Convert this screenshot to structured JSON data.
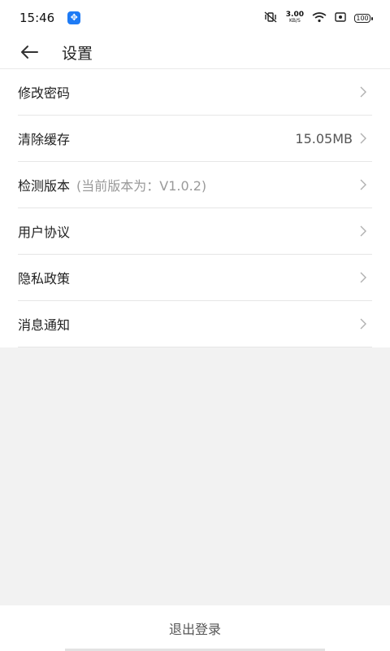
{
  "status_bar": {
    "time": "15:46",
    "app_icon": "app-icon",
    "speed_value": "3.00",
    "speed_unit": "KB/S",
    "battery": "100"
  },
  "header": {
    "title": "设置",
    "back_icon": "arrow-left-icon"
  },
  "settings": {
    "items": [
      {
        "label": "修改密码",
        "sub": "",
        "value": ""
      },
      {
        "label": "清除缓存",
        "sub": "",
        "value": "15.05MB"
      },
      {
        "label": "检测版本",
        "sub": "(当前版本为：V1.0.2)",
        "value": ""
      },
      {
        "label": "用户协议",
        "sub": "",
        "value": ""
      },
      {
        "label": "隐私政策",
        "sub": "",
        "value": ""
      },
      {
        "label": "消息通知",
        "sub": "",
        "value": ""
      }
    ]
  },
  "footer": {
    "logout_label": "退出登录"
  },
  "colors": {
    "background": "#f2f2f2",
    "surface": "#ffffff",
    "divider": "#e6e6e6",
    "text": "#222222",
    "muted": "#9a9a9a",
    "app_badge": "#1e7bf5"
  }
}
